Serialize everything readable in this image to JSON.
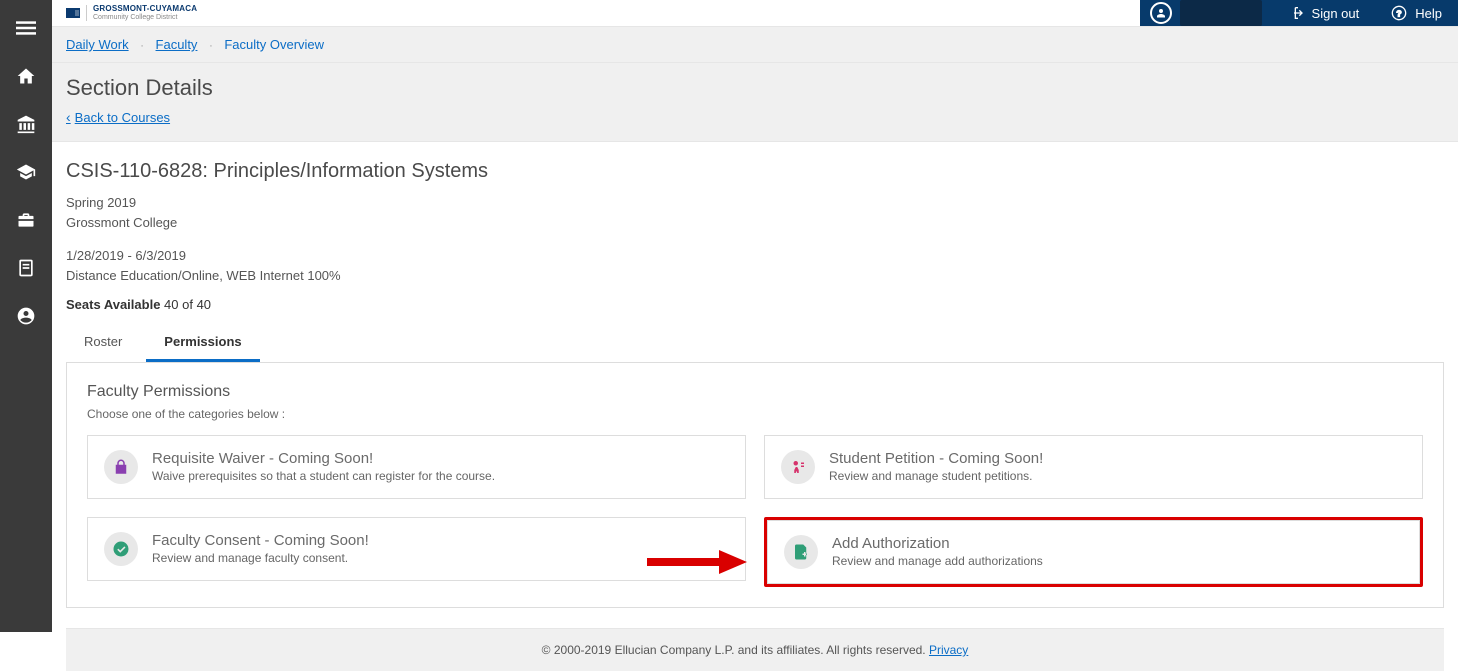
{
  "brand": {
    "title": "GROSSMONT-CUYAMACA",
    "subtitle": "Community College District"
  },
  "topbar": {
    "sign_out": "Sign out",
    "help": "Help"
  },
  "breadcrumb": {
    "daily_work": "Daily Work",
    "faculty": "Faculty",
    "current": "Faculty Overview"
  },
  "page": {
    "title": "Section Details",
    "back": "Back to Courses"
  },
  "section": {
    "course_title": "CSIS-110-6828: Principles/Information Systems",
    "term": "Spring 2019",
    "college": "Grossmont College",
    "dates": "1/28/2019 - 6/3/2019",
    "modality": "Distance Education/Online, WEB Internet 100%",
    "seats_label": "Seats Available",
    "seats_value": "40 of 40"
  },
  "tabs": {
    "roster": "Roster",
    "permissions": "Permissions"
  },
  "panel": {
    "heading": "Faculty Permissions",
    "hint": "Choose one of the categories below :"
  },
  "cards": {
    "requisite": {
      "title": "Requisite Waiver - Coming Soon!",
      "desc": "Waive prerequisites so that a student can register for the course."
    },
    "petition": {
      "title": "Student Petition - Coming Soon!",
      "desc": "Review and manage student petitions."
    },
    "consent": {
      "title": "Faculty Consent - Coming Soon!",
      "desc": "Review and manage faculty consent."
    },
    "addauth": {
      "title": "Add Authorization",
      "desc": "Review and manage add authorizations"
    }
  },
  "footer": {
    "copyright": "© 2000-2019 Ellucian Company L.P. and its affiliates. All rights reserved.",
    "privacy": "Privacy"
  }
}
